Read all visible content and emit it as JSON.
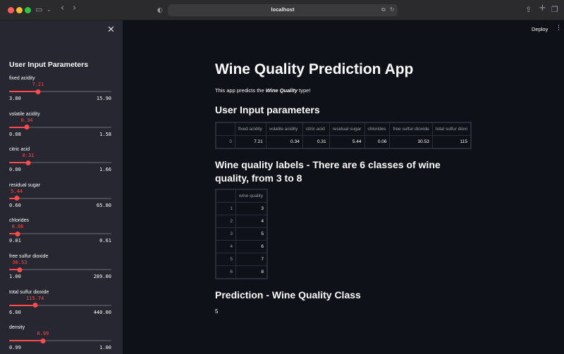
{
  "browser": {
    "url": "localhost",
    "nav_sidebar_icon": "sidebar-icon",
    "back_icon": "‹",
    "forward_icon": "›"
  },
  "sidebar": {
    "title": "User Input Parameters",
    "sliders": [
      {
        "label": "fixed acidity",
        "value": "7.21",
        "min": "3.80",
        "max": "15.90",
        "fraction": 0.282
      },
      {
        "label": "volatile acidity",
        "value": "0.34",
        "min": "0.08",
        "max": "1.58",
        "fraction": 0.173
      },
      {
        "label": "citric acid",
        "value": "0.31",
        "min": "0.00",
        "max": "1.66",
        "fraction": 0.187
      },
      {
        "label": "residual sugar",
        "value": "5.44",
        "min": "0.60",
        "max": "65.80",
        "fraction": 0.074
      },
      {
        "label": "chlorides",
        "value": "0.06",
        "min": "0.01",
        "max": "0.61",
        "fraction": 0.083
      },
      {
        "label": "free sulfur dioxide",
        "value": "30.53",
        "min": "1.00",
        "max": "289.00",
        "fraction": 0.103
      },
      {
        "label": "total sulfur dioxide",
        "value": "115.74",
        "min": "6.00",
        "max": "440.00",
        "fraction": 0.253
      },
      {
        "label": "density",
        "value": "0.99",
        "min": "0.99",
        "max": "1.00",
        "fraction": 0.33
      }
    ]
  },
  "header": {
    "deploy_label": "Deploy",
    "menu_icon": "⋮"
  },
  "main": {
    "title": "Wine Quality Prediction App",
    "intro_prefix": "This app predicts the ",
    "intro_emphasis": "Wine Quality",
    "intro_suffix": " type!",
    "input_heading": "User Input parameters",
    "input_table": {
      "columns": [
        "",
        "fixed acidity",
        "volatile acidity",
        "citric acid",
        "residual sugar",
        "chlorides",
        "free sulfur dioxide",
        "total sulfur dioxi"
      ],
      "rows": [
        [
          "0",
          "7.21",
          "0.34",
          "0.31",
          "5.44",
          "0.06",
          "30.53",
          "115"
        ]
      ]
    },
    "labels_heading": "Wine quality labels - There are 6 classes of wine quality, from 3 to 8",
    "labels_table": {
      "columns": [
        "",
        "wine quality"
      ],
      "rows": [
        [
          "1",
          "3"
        ],
        [
          "2",
          "4"
        ],
        [
          "3",
          "5"
        ],
        [
          "4",
          "6"
        ],
        [
          "5",
          "7"
        ],
        [
          "6",
          "8"
        ]
      ]
    },
    "prediction_heading": "Prediction - Wine Quality Class",
    "prediction_value": "5"
  }
}
